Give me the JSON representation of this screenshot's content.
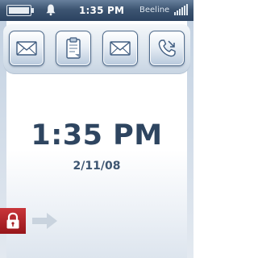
{
  "status_bar": {
    "time": "1:35 PM",
    "carrier": "Beeline",
    "icons": [
      "battery-icon",
      "bell-icon",
      "signal-strength-icon"
    ]
  },
  "launcher": {
    "buttons": [
      {
        "name": "messaging",
        "icon": "envelope-icon"
      },
      {
        "name": "tasks",
        "icon": "clipboard-icon"
      },
      {
        "name": "email",
        "icon": "envelope-icon"
      },
      {
        "name": "call-log",
        "icon": "phone-icon"
      }
    ]
  },
  "clock": {
    "time": "1:35 PM",
    "date": "2/11/08"
  },
  "lock": {
    "icon": "padlock-icon",
    "arrow_icon": "right-arrow-icon"
  },
  "colors": {
    "status_bar": "#3d5572",
    "clock_text": "#2e4560",
    "lock_red": "#b5242a"
  }
}
